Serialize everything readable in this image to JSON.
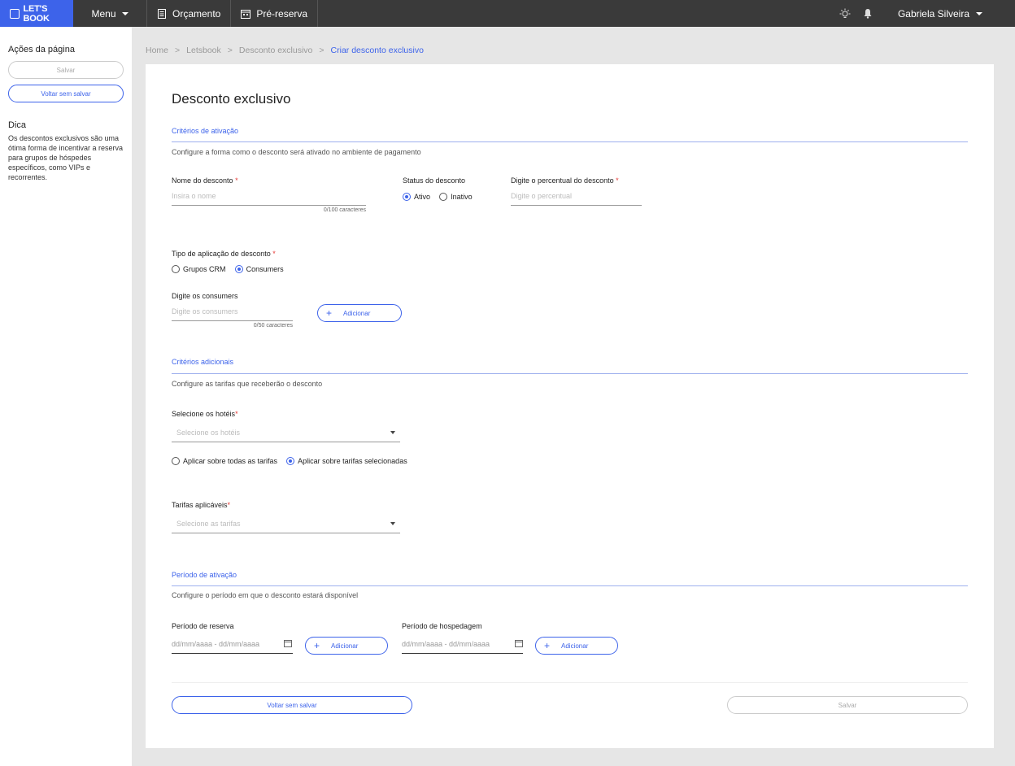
{
  "topbar": {
    "logo": "LET'S BOOK",
    "menu_label": "Menu",
    "nav": [
      {
        "label": "Orçamento",
        "icon": "document-icon"
      },
      {
        "label": "Pré-reserva",
        "icon": "calendar-icon"
      }
    ],
    "user_name": "Gabriela Silveira"
  },
  "sidebar": {
    "actions_title": "Ações da página",
    "save_label": "Salvar",
    "back_label": "Voltar sem salvar",
    "tip_title": "Dica",
    "tip_text": "Os descontos exclusivos são uma ótima forma de incentivar a reserva para grupos de hóspedes específicos, como VIPs e recorrentes."
  },
  "breadcrumb": [
    "Home",
    "Letsbook",
    "Desconto exclusivo",
    "Criar desconto exclusivo"
  ],
  "form": {
    "title": "Desconto exclusivo",
    "activation": {
      "title": "Critérios de ativação",
      "desc": "Configure a forma como o desconto será ativado no ambiente de pagamento",
      "name_label": "Nome do desconto",
      "name_placeholder": "Insira o nome",
      "name_counter": "0/100 caracteres",
      "status_label": "Status do desconto",
      "status_options": [
        "Ativo",
        "Inativo"
      ],
      "status_selected": "Ativo",
      "percent_label": "Digite o percentual do desconto",
      "percent_placeholder": "Digite o percentual",
      "type_label": "Tipo de aplicação de desconto",
      "type_options": [
        "Grupos CRM",
        "Consumers"
      ],
      "type_selected": "Consumers",
      "consumers_label": "Digite os consumers",
      "consumers_placeholder": "Digite os consumers",
      "consumers_counter": "0/50 caracteres",
      "add_label": "Adicionar"
    },
    "additional": {
      "title": "Critérios adicionais",
      "desc": "Configure as tarifas que receberão o desconto",
      "hotels_label": "Selecione os hotéis",
      "hotels_placeholder": "Selecione os hotéis",
      "apply_options": [
        "Aplicar sobre todas as tarifas",
        "Aplicar sobre tarifas selecionadas"
      ],
      "apply_selected": "Aplicar sobre tarifas selecionadas",
      "rates_label": "Tarifas aplicáveis",
      "rates_placeholder": "Selecione as tarifas"
    },
    "period": {
      "title": "Período de ativação",
      "desc": "Configure o período em que o desconto estará disponível",
      "booking_label": "Período de reserva",
      "booking_placeholder": "dd/mm/aaaa - dd/mm/aaaa",
      "stay_label": "Período de hospedagem",
      "stay_placeholder": "dd/mm/aaaa - dd/mm/aaaa",
      "add_label": "Adicionar"
    },
    "footer": {
      "back_label": "Voltar sem salvar",
      "save_label": "Salvar"
    }
  },
  "colors": {
    "accent": "#3d63ea",
    "topbar": "#3a3a3a",
    "required": "#e53935"
  }
}
